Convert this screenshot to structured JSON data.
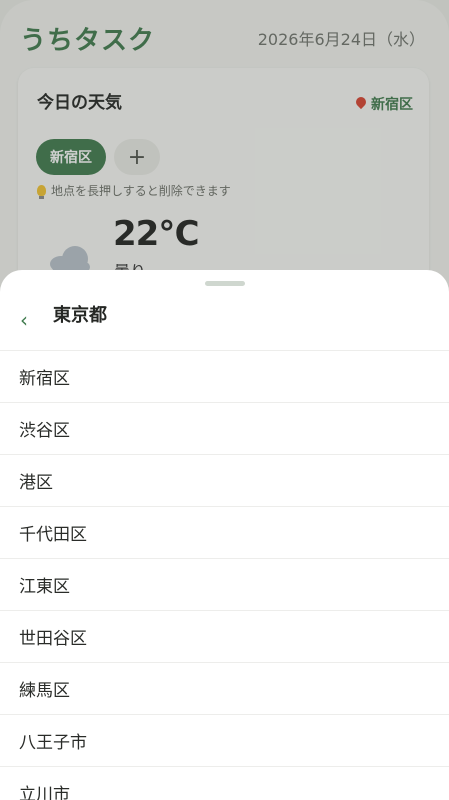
{
  "header": {
    "app_title": "うちタスク",
    "date": "2026年6月24日（水）"
  },
  "weather": {
    "card_title": "今日の天気",
    "location": "新宿区",
    "chips": [
      "新宿区"
    ],
    "add_chip": "+",
    "hint": "地点を長押しすると削除できます",
    "temperature": "22℃",
    "condition": "曇り"
  },
  "sheet": {
    "back": "‹",
    "title": "東京都",
    "cities": [
      "新宿区",
      "渋谷区",
      "港区",
      "千代田区",
      "江東区",
      "世田谷区",
      "練馬区",
      "八王子市",
      "立川市"
    ]
  },
  "colors": {
    "accent": "#3e7a4c",
    "pin": "#d9412f"
  }
}
